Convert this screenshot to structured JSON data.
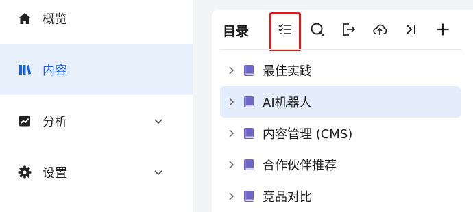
{
  "sidebar": {
    "items": [
      {
        "label": "概览",
        "icon": "home-icon",
        "active": false
      },
      {
        "label": "内容",
        "icon": "library-icon",
        "active": true
      },
      {
        "label": "分析",
        "icon": "chart-icon",
        "active": false,
        "expandable": true
      },
      {
        "label": "设置",
        "icon": "gear-icon",
        "active": false,
        "expandable": true
      }
    ]
  },
  "panel": {
    "title": "目录",
    "toolbar": [
      "checklist-icon",
      "search-icon",
      "export-icon",
      "upload-icon",
      "collapse-icon",
      "add-icon"
    ],
    "tree": [
      {
        "label": "最佳实践",
        "selected": false
      },
      {
        "label": "AI机器人",
        "selected": true
      },
      {
        "label": "内容管理 (CMS)",
        "selected": false
      },
      {
        "label": "合作伙伴推荐",
        "selected": false
      },
      {
        "label": "竞品对比",
        "selected": false
      }
    ]
  },
  "colors": {
    "accent": "#1763e6",
    "active_bg": "#e7effb",
    "selected_bg": "#e3edfb",
    "highlight": "#e11b1b",
    "book": "#6e67c7"
  }
}
